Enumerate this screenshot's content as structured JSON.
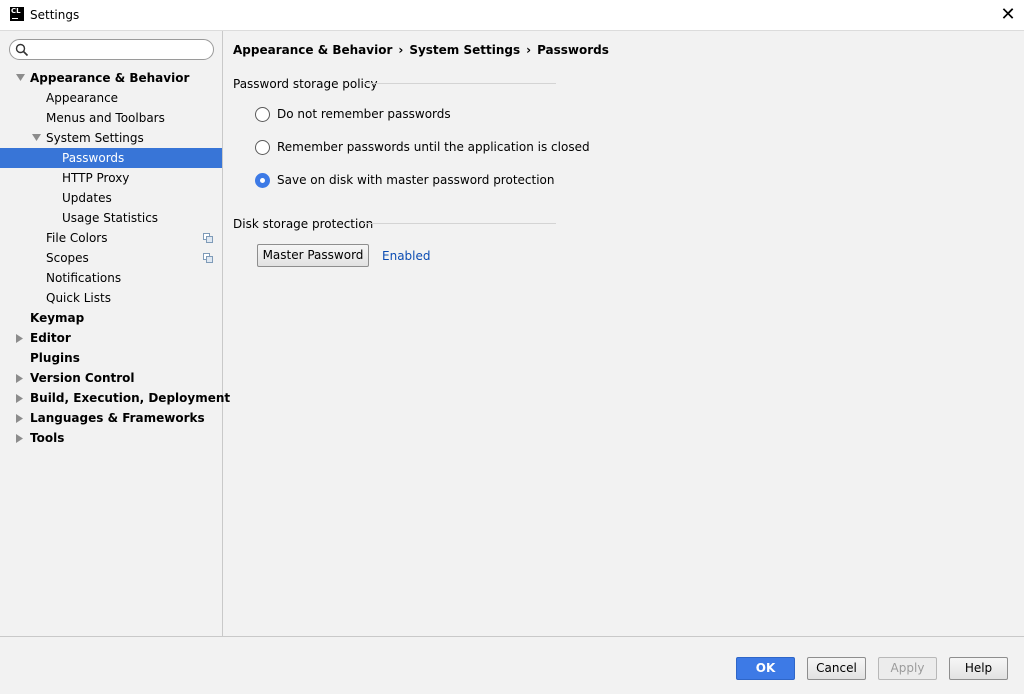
{
  "window": {
    "title": "Settings",
    "app_icon_text": "CL",
    "close_glyph": "✕"
  },
  "search": {
    "placeholder": "",
    "value": ""
  },
  "tree": {
    "appearance_behavior": "Appearance & Behavior",
    "appearance": "Appearance",
    "menus_toolbars": "Menus and Toolbars",
    "system_settings": "System Settings",
    "passwords": "Passwords",
    "http_proxy": "HTTP Proxy",
    "updates": "Updates",
    "usage_statistics": "Usage Statistics",
    "file_colors": "File Colors",
    "scopes": "Scopes",
    "notifications": "Notifications",
    "quick_lists": "Quick Lists",
    "keymap": "Keymap",
    "editor": "Editor",
    "plugins": "Plugins",
    "version_control": "Version Control",
    "build_execution": "Build, Execution, Deployment",
    "languages_frameworks": "Languages & Frameworks",
    "tools": "Tools",
    "selected": "Passwords"
  },
  "breadcrumb": {
    "part1": "Appearance & Behavior",
    "part2": "System Settings",
    "part3": "Passwords",
    "separator": "›"
  },
  "policy": {
    "title": "Password storage policy",
    "options": [
      {
        "label": "Do not remember passwords",
        "checked": false
      },
      {
        "label": "Remember passwords until the application is closed",
        "checked": false
      },
      {
        "label": "Save on disk with master password protection",
        "checked": true
      }
    ]
  },
  "disk_protection": {
    "title": "Disk storage protection",
    "button_label": "Master Password",
    "status": "Enabled"
  },
  "footer": {
    "ok": "OK",
    "cancel": "Cancel",
    "apply": "Apply",
    "help": "Help"
  },
  "colors": {
    "selection": "#3875d7",
    "accent": "#3d7ae6",
    "link": "#0b4cb3"
  }
}
